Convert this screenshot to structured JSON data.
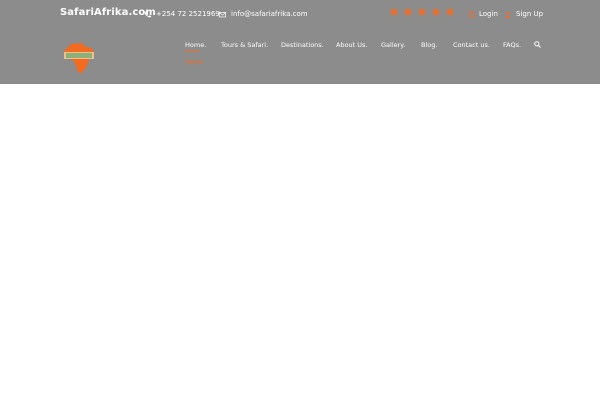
{
  "header": {
    "brand": "SafariAfrika.com",
    "phone": "+254 72 2521969",
    "email": "info@safariafrika.com",
    "login_label": "Login",
    "signup_label": "Sign Up",
    "social_icons": [
      "youtube-icon",
      "facebook-icon",
      "twitter-icon",
      "instagram-icon",
      "pinterest-icon"
    ],
    "accent_color": "#f36b21",
    "header_bg_color": "#8c8c8c"
  },
  "nav": {
    "items": [
      {
        "label": "Home."
      },
      {
        "label": "Tours & Safari."
      },
      {
        "label": "Destinations."
      },
      {
        "label": "About Us."
      },
      {
        "label": "Gallery."
      },
      {
        "label": "Blog."
      },
      {
        "label": "Contact us."
      },
      {
        "label": "FAQs."
      }
    ],
    "active_subitem": "Home"
  }
}
